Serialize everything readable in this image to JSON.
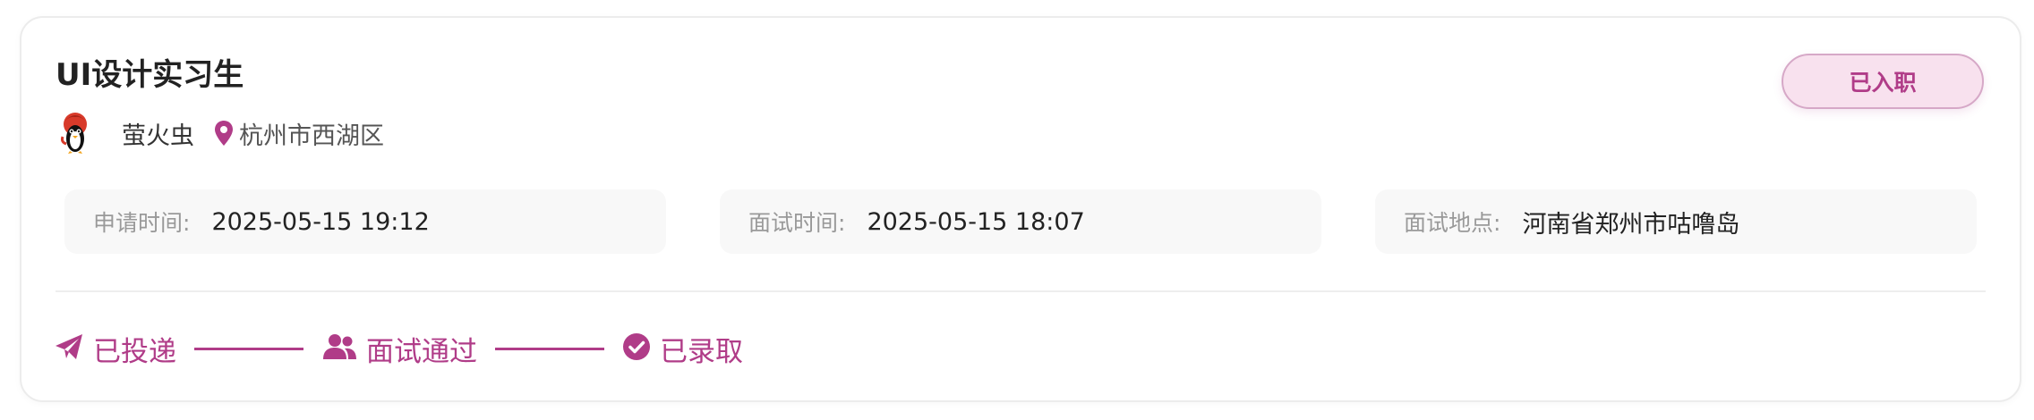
{
  "job": {
    "title": "UI设计实习生",
    "status": "已入职",
    "company": "萤火虫",
    "location": "杭州市西湖区"
  },
  "details": [
    {
      "label": "申请时间:",
      "value": "2025-05-15 19:12"
    },
    {
      "label": "面试时间:",
      "value": "2025-05-15 18:07"
    },
    {
      "label": "面试地点:",
      "value": "河南省郑州市咕噜岛"
    }
  ],
  "progress": [
    {
      "label": "已投递",
      "icon": "paper-plane-icon"
    },
    {
      "label": "面试通过",
      "icon": "users-icon"
    },
    {
      "label": "已录取",
      "icon": "check-circle-icon"
    }
  ],
  "colors": {
    "accent": "#b03c88",
    "badge_bg": "#f8e1ee",
    "info_bg": "#f8f8f8"
  }
}
